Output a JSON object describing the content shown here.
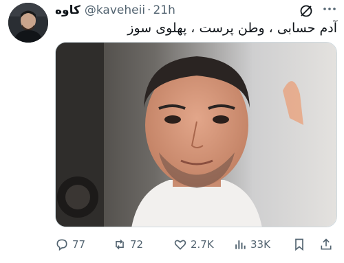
{
  "tweet": {
    "author_name": "کاوه",
    "author_handle": "@kaveheii",
    "separator": "·",
    "time": "21h",
    "text": "آدم حسابی ، وطن پرست ، پهلوی سوز",
    "avatar_icon": "user-avatar",
    "media_description_icon": "photo"
  },
  "actions": {
    "replies": "77",
    "reposts": "72",
    "likes": "2.7K",
    "views": "33K"
  },
  "icons": {
    "more": "more-icon",
    "grok": "grok-icon",
    "reply": "reply-icon",
    "repost": "repost-icon",
    "like": "heart-icon",
    "views": "views-icon",
    "bookmark": "bookmark-icon",
    "share": "share-icon"
  },
  "colors": {
    "text": "#0f1419",
    "secondary": "#536471",
    "border": "#cfd9de"
  }
}
